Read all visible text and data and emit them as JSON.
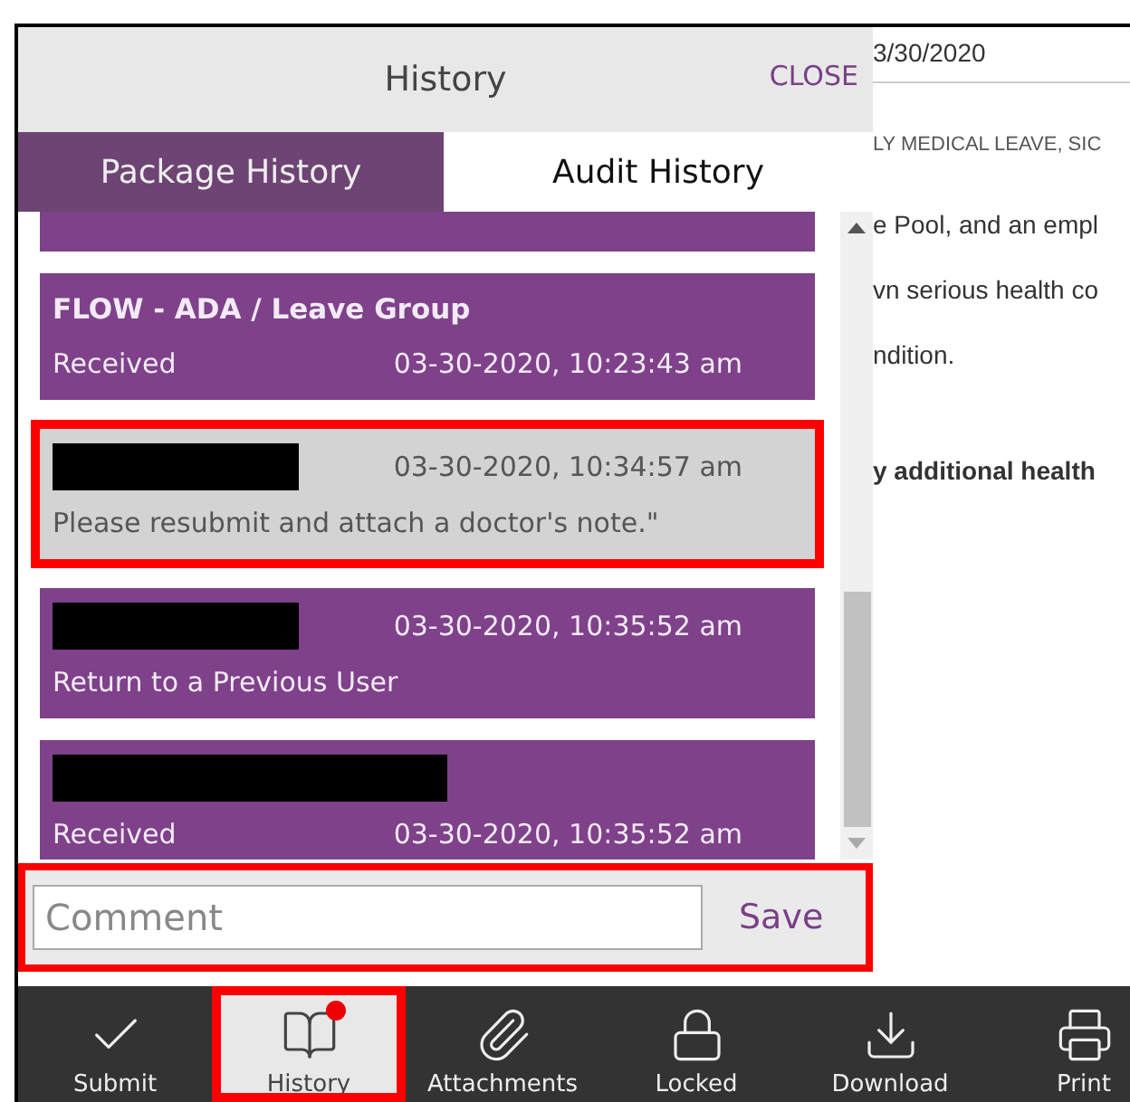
{
  "panel": {
    "title": "History",
    "close": "CLOSE",
    "tabs": [
      {
        "label": "Package History",
        "selected": true
      },
      {
        "label": "Audit History",
        "selected": false
      }
    ],
    "entries": [
      {
        "kind": "status",
        "title": "FLOW - ADA / Leave Group",
        "text": "Received",
        "time": "03-30-2020, 10:23:43 am",
        "highlighted": false
      },
      {
        "kind": "comment",
        "redacted": true,
        "wide_redaction": false,
        "text": "Please resubmit and attach a doctor's note.\"",
        "time": "03-30-2020, 10:34:57 am",
        "highlighted": true
      },
      {
        "kind": "action",
        "redacted": true,
        "wide_redaction": false,
        "text": "Return to a Previous User",
        "time": "03-30-2020, 10:35:52 am",
        "highlighted": false
      },
      {
        "kind": "status",
        "redacted": true,
        "wide_redaction": true,
        "text": "Received",
        "time": "03-30-2020, 10:35:52 am",
        "highlighted": false
      }
    ],
    "comment": {
      "placeholder": "Comment",
      "save": "Save",
      "highlighted": true
    }
  },
  "document": {
    "lines": [
      {
        "kind": "date",
        "text": "3/30/2020"
      },
      {
        "kind": "caps",
        "text": "LY MEDICAL LEAVE, SIC"
      },
      {
        "kind": "body",
        "text": "e Pool, and an empl"
      },
      {
        "kind": "body",
        "text": "vn serious health co"
      },
      {
        "kind": "body",
        "text": "ndition."
      },
      {
        "kind": "bold",
        "text": "y additional health"
      }
    ]
  },
  "toolbar": [
    {
      "kind": "check",
      "label": "Submit",
      "selected": false,
      "highlighted": false,
      "badge": false
    },
    {
      "kind": "book",
      "label": "History",
      "selected": true,
      "highlighted": true,
      "badge": true
    },
    {
      "kind": "paperclip",
      "label": "Attachments",
      "selected": false,
      "highlighted": false,
      "badge": false
    },
    {
      "kind": "lock",
      "label": "Locked",
      "selected": false,
      "highlighted": false,
      "badge": false
    },
    {
      "kind": "download",
      "label": "Download",
      "selected": false,
      "highlighted": false,
      "badge": false
    },
    {
      "kind": "printer",
      "label": "Print",
      "selected": false,
      "highlighted": false,
      "badge": false
    }
  ]
}
